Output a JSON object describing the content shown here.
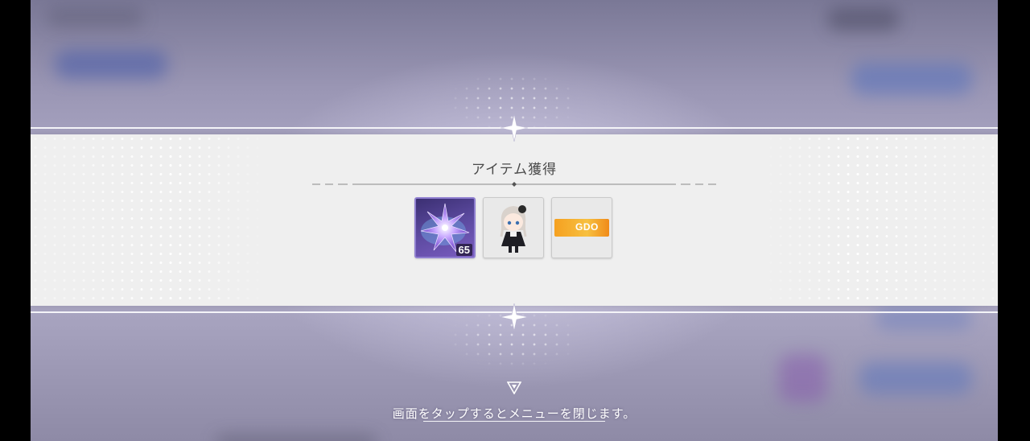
{
  "dialog": {
    "title": "アイテム獲得",
    "items": [
      {
        "name": "crystal-shard",
        "quantity": "65"
      },
      {
        "name": "chibi-character"
      },
      {
        "name": "gdo-ticket",
        "label": "GDO"
      }
    ]
  },
  "footer": {
    "close_hint": "画面をタップするとメニューを閉じます。"
  },
  "colors": {
    "panel": "#efefef",
    "title_text": "#4a4a4a",
    "ticket": "#f5a020",
    "gem": "#5c4aa0"
  }
}
